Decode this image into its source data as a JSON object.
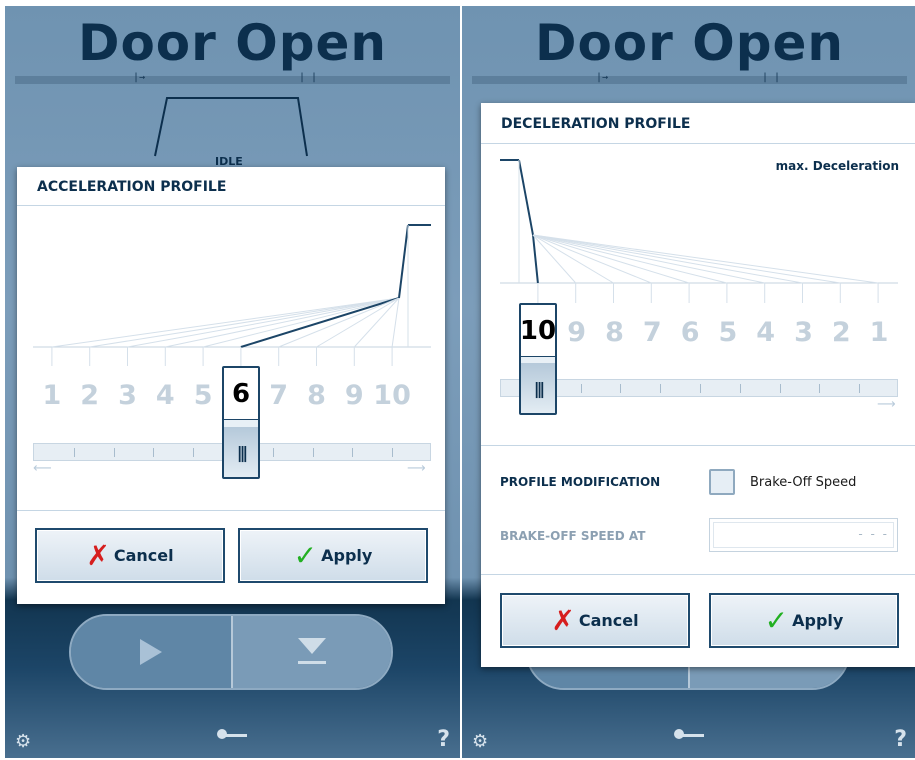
{
  "screens": [
    {
      "background": {
        "title": "Door Open",
        "status": "IDLE"
      },
      "dialog": {
        "title": "ACCELERATION PROFILE",
        "steps": [
          "1",
          "2",
          "3",
          "4",
          "5",
          "6",
          "7",
          "8",
          "9",
          "10"
        ],
        "selected_value": "6",
        "cancel_label": "Cancel",
        "apply_label": "Apply"
      }
    },
    {
      "background": {
        "title": "Door Open"
      },
      "dialog": {
        "title": "DECELERATION PROFILE",
        "max_label": "max. Deceleration",
        "steps": [
          "10",
          "9",
          "8",
          "7",
          "6",
          "5",
          "4",
          "3",
          "2",
          "1"
        ],
        "selected_value": "10",
        "profile_modification_label": "PROFILE MODIFICATION",
        "brake_off_checkbox_label": "Brake-Off Speed",
        "brake_off_checked": false,
        "brake_off_speed_label": "BRAKE-OFF SPEED AT",
        "brake_off_speed_value": "- - -",
        "cancel_label": "Cancel",
        "apply_label": "Apply"
      }
    }
  ],
  "icons": {
    "settings": "gear-icon",
    "key": "key-icon",
    "help": "help-icon",
    "cancel": "x-icon",
    "apply": "check-icon"
  },
  "colors": {
    "primary": "#0c2f4d",
    "accent_blue": "#1c4567",
    "cancel_red": "#d61e1e",
    "apply_green": "#22b022"
  }
}
